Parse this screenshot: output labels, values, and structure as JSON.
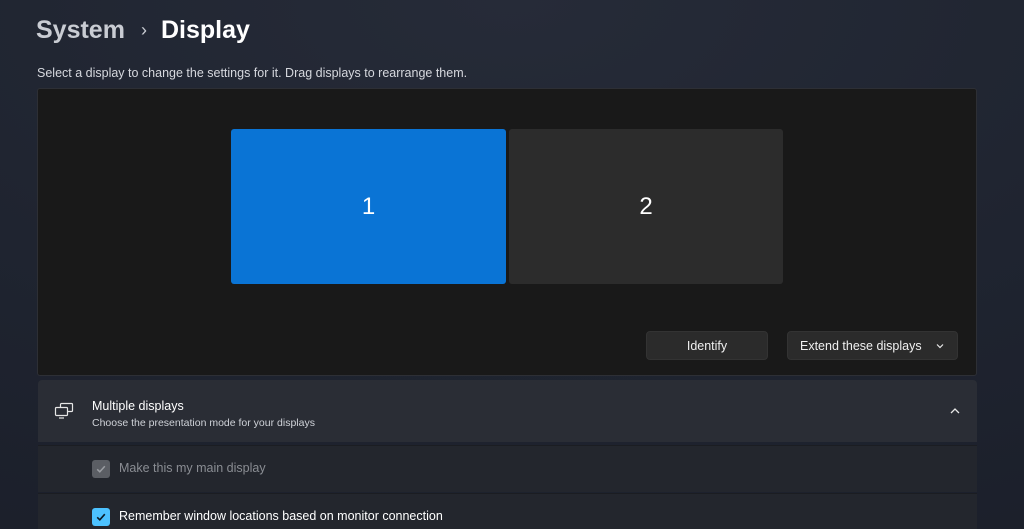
{
  "breadcrumb": {
    "parent": "System",
    "separator": "›",
    "current": "Display"
  },
  "instructions": "Select a display to change the settings for it. Drag displays to rearrange them.",
  "displays": [
    {
      "label": "1",
      "selected": true,
      "color": "#0a74d5"
    },
    {
      "label": "2",
      "selected": false,
      "color": "#2c2c2c"
    }
  ],
  "actions": {
    "identify_label": "Identify",
    "mode_selected": "Extend these displays"
  },
  "multiple_displays": {
    "icon": "multiple-displays-icon",
    "title": "Multiple displays",
    "description": "Choose the presentation mode for your displays",
    "expanded": true,
    "options": [
      {
        "label": "Make this my main display",
        "checked": true,
        "enabled": false
      },
      {
        "label": "Remember window locations based on monitor connection",
        "checked": true,
        "enabled": true
      }
    ]
  },
  "colors": {
    "accent": "#4cc2ff",
    "selected_display": "#0a74d5"
  }
}
